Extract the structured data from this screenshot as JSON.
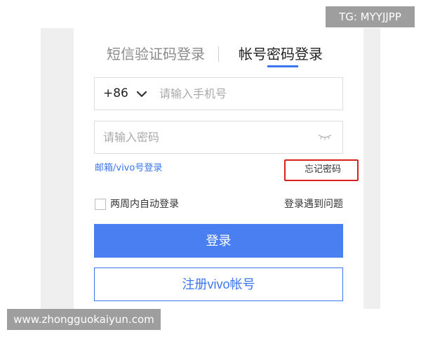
{
  "tabs": {
    "sms_login": "短信验证码登录",
    "password_login": "帐号密码登录"
  },
  "phone": {
    "country_code": "+86",
    "placeholder": "请输入手机号"
  },
  "password": {
    "placeholder": "请输入密码"
  },
  "links": {
    "email_vivo_login": "邮箱/vivo号登录",
    "forgot_password": "忘记密码",
    "remember_two_weeks": "两周内自动登录",
    "login_problem": "登录遇到问题"
  },
  "buttons": {
    "login": "登录",
    "register": "注册vivo帐号"
  },
  "watermarks": {
    "tg": "TG: MYYJJPP",
    "site": "www.zhongguokaiyun.com"
  },
  "colors": {
    "accent": "#3b76ee",
    "login_button": "#4a7ff2",
    "highlight_box": "#d9201f"
  },
  "icons": {
    "country_dropdown": "chevron-down-icon",
    "password_visibility": "eye-closed-icon"
  }
}
